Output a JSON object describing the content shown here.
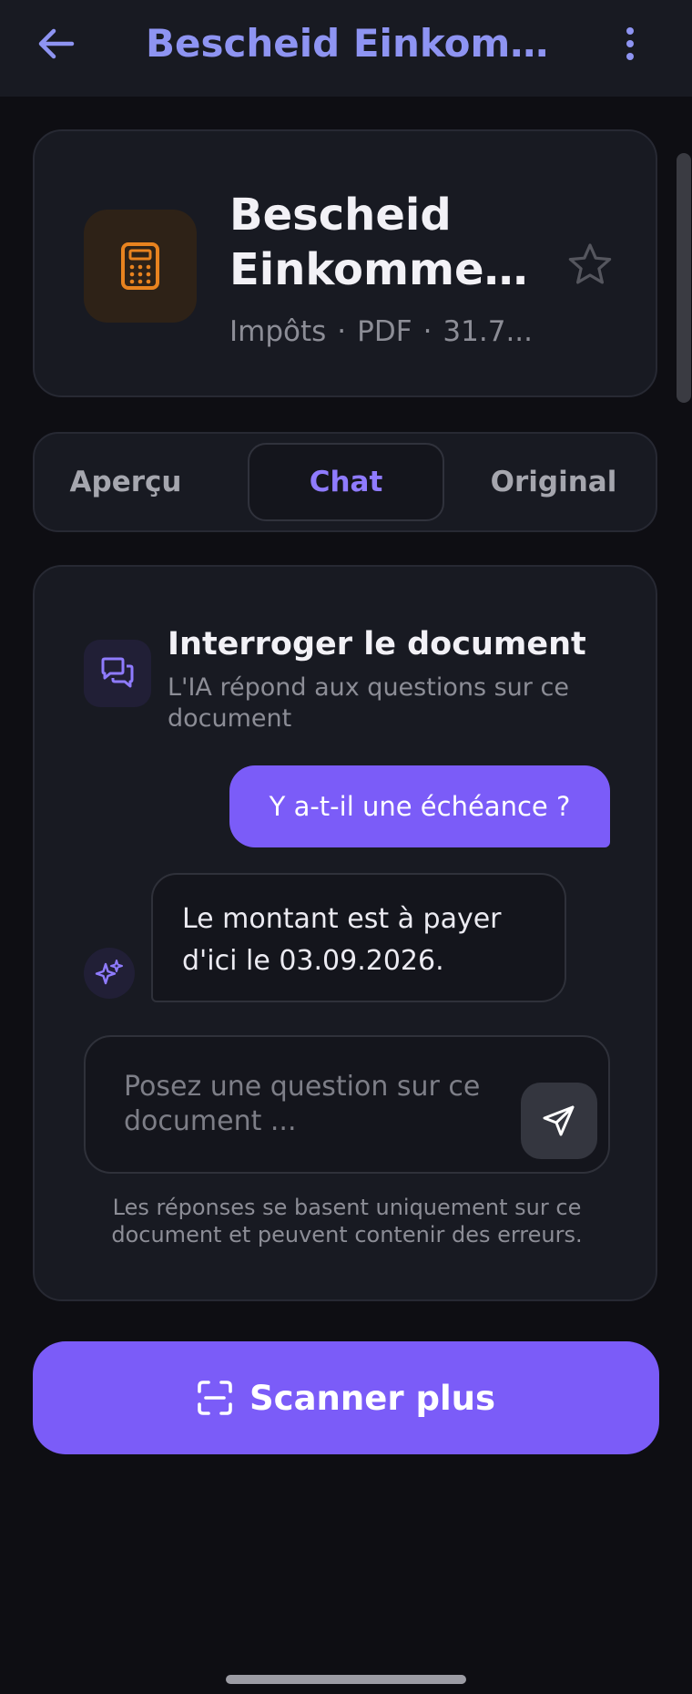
{
  "appbar": {
    "title": "Bescheid Einkommen...",
    "back_icon": "arrow-left-icon",
    "more_icon": "more-vertical-icon"
  },
  "document": {
    "title_line1": "Bescheid",
    "title_line2": "Einkommen...",
    "category": "Impôts",
    "separator": "·",
    "format": "PDF",
    "size": "31.7...",
    "icon": "calculator-icon",
    "favorite_icon": "star-icon"
  },
  "tabs": [
    {
      "label": "Aperçu",
      "active": false
    },
    {
      "label": "Chat",
      "active": true
    },
    {
      "label": "Original",
      "active": false
    }
  ],
  "chat": {
    "heading": "Interroger le document",
    "subheading": "L'IA répond aux questions sur ce document",
    "icon": "chat-bubbles-icon",
    "messages": [
      {
        "role": "user",
        "text": "Y a-t-il une échéance ?"
      },
      {
        "role": "assistant",
        "text": "Le montant est à payer d'ici le 03.09.2026."
      }
    ],
    "assistant_icon": "sparkles-icon",
    "input": {
      "value": "",
      "placeholder": "Posez une question sur ce document ..."
    },
    "send_icon": "send-icon",
    "disclaimer": "Les réponses se basent uniquement sur ce document et peuvent contenir des erreurs."
  },
  "scan_button": {
    "label": "Scanner plus",
    "icon": "scan-icon"
  },
  "colors": {
    "accent": "#7b5cf8",
    "title_accent": "#8e94f2",
    "background": "#0e0e13",
    "card": "#181a22",
    "doc_icon": "#e8831f"
  }
}
